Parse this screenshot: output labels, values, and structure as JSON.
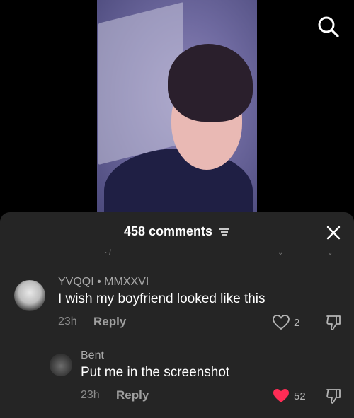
{
  "header": {
    "comment_count": "458 comments"
  },
  "comments": [
    {
      "username": "YVQQI • MMXXVI",
      "text": "I wish my boyfriend looked like this",
      "time": "23h",
      "reply_label": "Reply",
      "likes": "2",
      "liked": false
    },
    {
      "username": "Bent",
      "text": "Put me in the screenshot",
      "time": "23h",
      "reply_label": "Reply",
      "likes": "52",
      "liked": true
    }
  ],
  "colors": {
    "sheet_bg": "#252525",
    "like_red": "#fe2c55"
  },
  "icons": [
    "search-icon",
    "filter-icon",
    "close-icon",
    "heart-icon",
    "thumbs-down-icon"
  ]
}
